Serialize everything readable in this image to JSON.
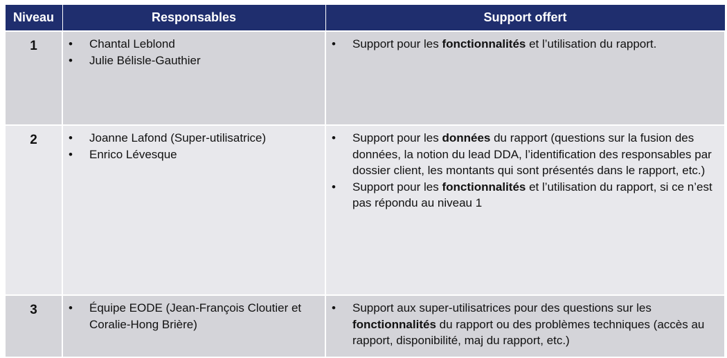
{
  "headers": {
    "level": "Niveau",
    "responsibles": "Responsables",
    "support": "Support offert"
  },
  "rows": [
    {
      "level": "1",
      "responsibles": [
        "Chantal Leblond",
        "Julie Bélisle-Gauthier"
      ],
      "support": [
        {
          "pre": "Support pour les ",
          "bold": "fonctionnalités",
          "post": " et l’utilisation du rapport."
        }
      ]
    },
    {
      "level": "2",
      "responsibles": [
        "Joanne Lafond (Super-utilisatrice)",
        "Enrico Lévesque"
      ],
      "support": [
        {
          "pre": "Support pour les ",
          "bold": "données",
          "post": " du rapport (questions sur la fusion des données, la notion du lead DDA, l’identification des responsables par dossier client, les montants qui sont présentés dans le rapport, etc.)"
        },
        {
          "pre": "Support pour les ",
          "bold": "fonctionnalités",
          "post": " et l’utilisation du rapport, si ce n’est pas répondu au niveau 1"
        }
      ]
    },
    {
      "level": "3",
      "responsibles": [
        "Équipe EODE (Jean-François Cloutier et Coralie-Hong Brière)"
      ],
      "support": [
        {
          "pre": "Support aux super-utilisatrices pour des questions sur les ",
          "bold": "fonctionnalités",
          "post": " du rapport ou des problèmes techniques (accès au rapport, disponibilité, maj du rapport, etc.)"
        }
      ]
    }
  ],
  "colors": {
    "header_bg": "#1f2e6e",
    "row_dark": "#d4d4d9",
    "row_light": "#e8e8ec"
  }
}
